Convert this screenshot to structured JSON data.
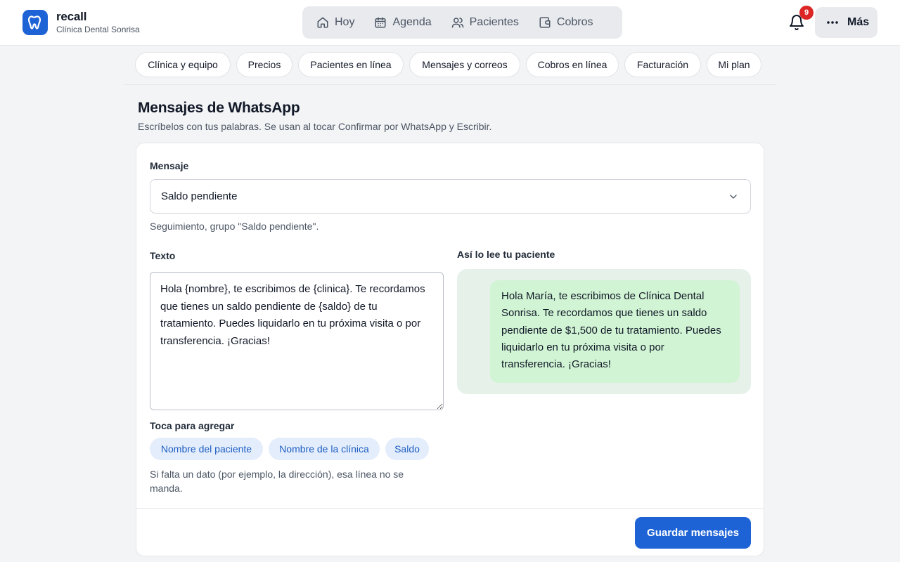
{
  "app": {
    "name": "recall",
    "clinic": "Clínica Dental Sonrisa",
    "logo_icon": "tooth-icon",
    "accent_color": "#1d63d6"
  },
  "main_nav": {
    "items": [
      {
        "label": "Hoy",
        "icon": "home-icon"
      },
      {
        "label": "Agenda",
        "icon": "calendar-icon"
      },
      {
        "label": "Pacientes",
        "icon": "users-icon"
      },
      {
        "label": "Cobros",
        "icon": "wallet-icon"
      }
    ]
  },
  "header_actions": {
    "notifications_count": "9",
    "more_label": "Más"
  },
  "settings_tabs": [
    {
      "label": "Clínica y equipo"
    },
    {
      "label": "Precios"
    },
    {
      "label": "Pacientes en línea"
    },
    {
      "label": "Mensajes y correos"
    },
    {
      "label": "Cobros en línea"
    },
    {
      "label": "Facturación"
    },
    {
      "label": "Mi plan"
    }
  ],
  "section": {
    "title": "Mensajes de WhatsApp",
    "description": "Escríbelos con tus palabras. Se usan al tocar Confirmar por WhatsApp y Escribir."
  },
  "form": {
    "message_label": "Mensaje",
    "message_selected": "Saldo pendiente",
    "message_hint": "Seguimiento, grupo \"Saldo pendiente\".",
    "text_label": "Texto",
    "text_value": "Hola {nombre}, te escribimos de {clinica}. Te recordamos que tienes un saldo pendiente de {saldo} de tu tratamiento. Puedes liquidarlo en tu próxima visita o por transferencia. ¡Gracias!",
    "chips_label": "Toca para agregar",
    "chips": [
      {
        "label": "Nombre del paciente"
      },
      {
        "label": "Nombre de la clínica"
      },
      {
        "label": "Saldo"
      }
    ],
    "missing_hint": "Si falta un dato (por ejemplo, la dirección), esa línea no se manda.",
    "preview_label": "Así lo lee tu paciente",
    "preview_text": "Hola María, te escribimos de Clínica Dental Sonrisa. Te recordamos que tienes un saldo pendiente de $1,500 de tu tratamiento. Puedes liquidarlo en tu próxima visita o por transferencia. ¡Gracias!",
    "save_label": "Guardar mensajes"
  }
}
